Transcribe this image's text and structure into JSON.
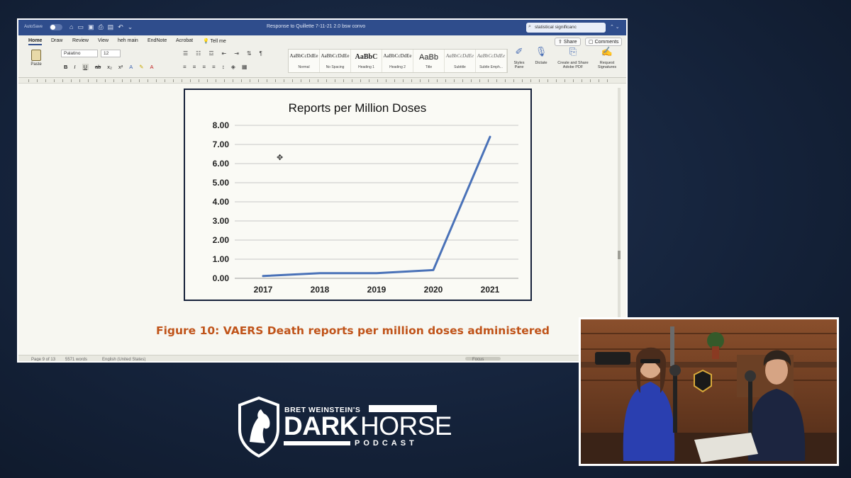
{
  "window": {
    "autosave_label": "AutoSave",
    "autosave_state": "OFF",
    "doc_title": "Response to Quillette 7-11-21 2.0 bsw convo",
    "search_value": "statistical significanc"
  },
  "tabs": [
    {
      "label": "Home",
      "active": true
    },
    {
      "label": "Draw"
    },
    {
      "label": "Review"
    },
    {
      "label": "View"
    },
    {
      "label": "heh main"
    },
    {
      "label": "EndNote"
    },
    {
      "label": "Acrobat"
    },
    {
      "label": "Tell me"
    }
  ],
  "actions": {
    "share": "Share",
    "comments": "Comments"
  },
  "ribbon": {
    "paste_label": "Paste",
    "font_name": "Palatino",
    "font_size": "12",
    "styles": [
      {
        "sample": "AaBbCcDdEe",
        "label": "Normal"
      },
      {
        "sample": "AaBbCcDdEe",
        "label": "No Spacing"
      },
      {
        "sample": "AaBbC",
        "label": "Heading 1"
      },
      {
        "sample": "AaBbCcDdEe",
        "label": "Heading 2"
      },
      {
        "sample": "AaBb",
        "label": "Title"
      },
      {
        "sample": "AaBbCcDdEe",
        "label": "Subtitle"
      },
      {
        "sample": "AaBbCcDdEe",
        "label": "Subtle Emph..."
      }
    ],
    "styles_pane": "Styles Pane",
    "dictate": "Dictate",
    "create_pdf": "Create and Share Adobe PDF",
    "request_signatures": "Request Signatures"
  },
  "status": {
    "page": "Page 9 of 13",
    "words": "5571 words",
    "language": "English (United States)",
    "focus": "Focus"
  },
  "caption": "Figure 10: VAERS Death reports per million doses administered",
  "chart_data": {
    "type": "line",
    "title": "Reports per Million Doses",
    "categories": [
      "2017",
      "2018",
      "2019",
      "2020",
      "2021"
    ],
    "values": [
      0.12,
      0.27,
      0.27,
      0.43,
      7.4
    ],
    "ylim": [
      0,
      8
    ],
    "yticks": [
      "0.00",
      "1.00",
      "2.00",
      "3.00",
      "4.00",
      "5.00",
      "6.00",
      "7.00",
      "8.00"
    ],
    "grid": true,
    "line_color": "#4a72b8"
  },
  "branding": {
    "kicker": "BRET WEINSTEIN'S",
    "dark": "DARK",
    "horse": "HORSE",
    "podcast": "PODCAST"
  }
}
